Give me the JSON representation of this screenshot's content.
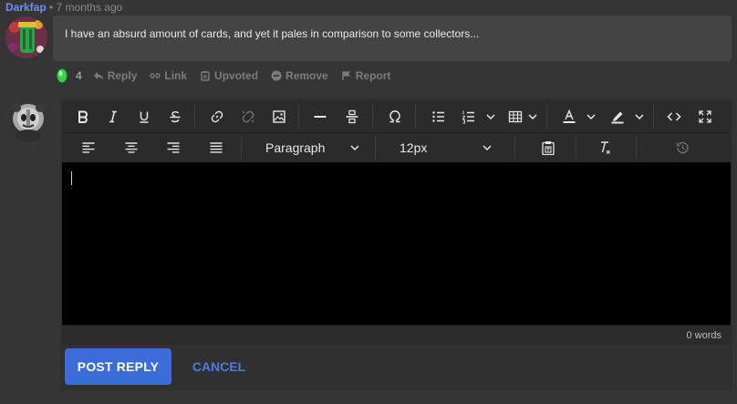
{
  "comment": {
    "author": "Darkfap",
    "separator": "•",
    "time": "7 months ago",
    "text": "I have an absurd amount of cards, and yet it pales in comparison to some collectors..."
  },
  "actions": {
    "score": "4",
    "reply": "Reply",
    "link": "Link",
    "upvoted": "Upvoted",
    "remove": "Remove",
    "report": "Report"
  },
  "editor": {
    "block_format": "Paragraph",
    "font_size": "12px",
    "word_count": "0 words",
    "content": ""
  },
  "buttons": {
    "post": "POST REPLY",
    "cancel": "CANCEL"
  },
  "colors": {
    "author": "#6f8ef5",
    "accent": "#3b6cd8",
    "gem": "#3ccf4e"
  }
}
